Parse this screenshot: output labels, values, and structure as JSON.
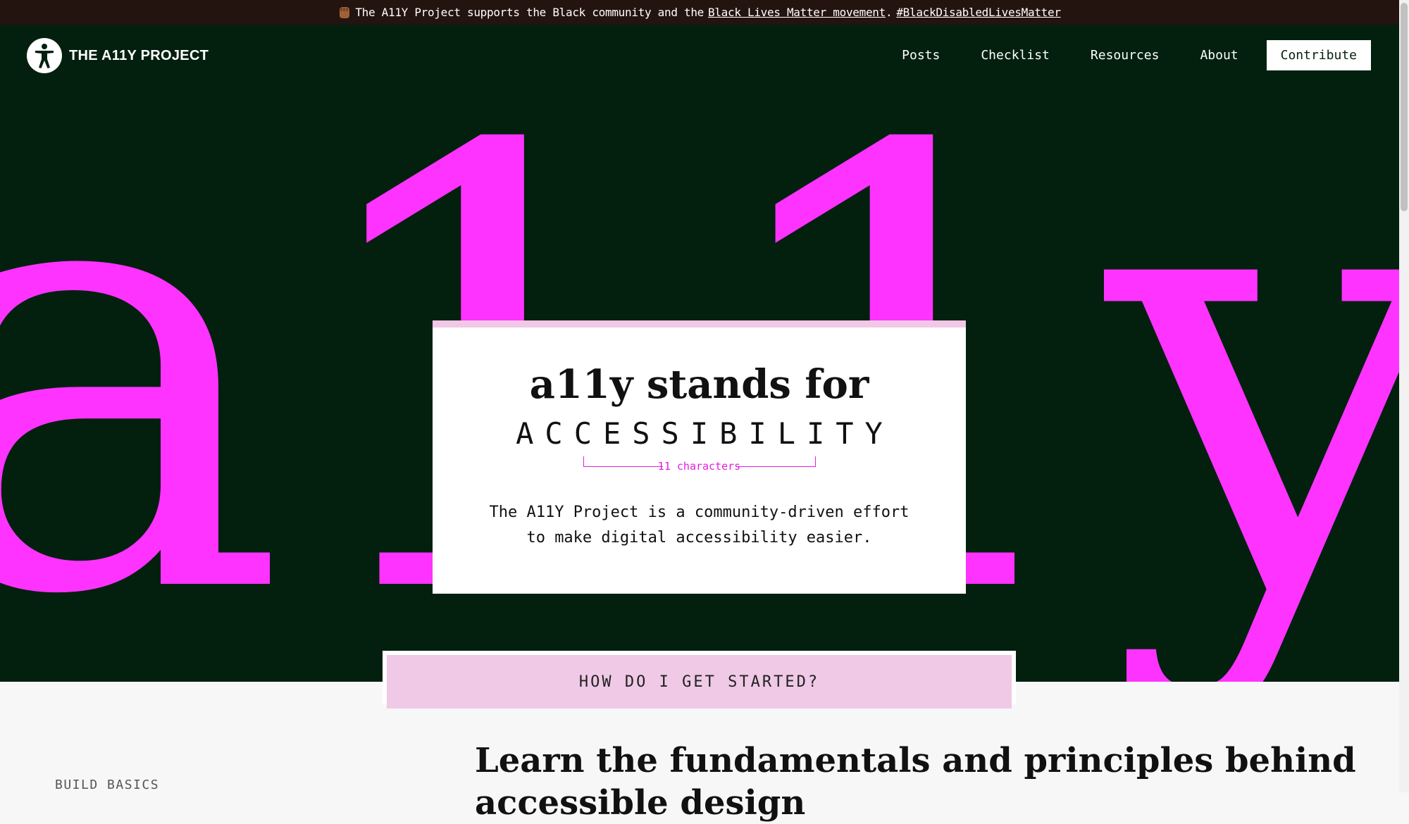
{
  "banner": {
    "text_prefix": "The A11Y Project supports the Black community and the",
    "link_blm": "Black Lives Matter movement",
    "separator": ".",
    "link_hashtag": "#BlackDisabledLivesMatter",
    "icon": "raised-fist-icon"
  },
  "header": {
    "logo_text": "THE A11Y PROJECT",
    "logo_icon": "accessibility-person-icon",
    "nav": [
      "Posts",
      "Checklist",
      "Resources",
      "About"
    ],
    "contribute": "Contribute"
  },
  "hero": {
    "background_letters": "a11y",
    "title": "a11y stands for",
    "accessibility": "ACCESSIBILITY",
    "count_label": "11 characters",
    "description_line1": "The A11Y Project is a community-driven effort",
    "description_line2": "to make digital accessibility easier."
  },
  "started": {
    "label": "HOW DO I GET STARTED?"
  },
  "main": {
    "section_label": "BUILD BASICS",
    "heading": "Learn the fundamentals and principles behind accessible design"
  },
  "colors": {
    "dark_green": "#03200f",
    "magenta": "#ff33ff",
    "pink": "#efc9e6",
    "banner_bg": "#24140f"
  }
}
